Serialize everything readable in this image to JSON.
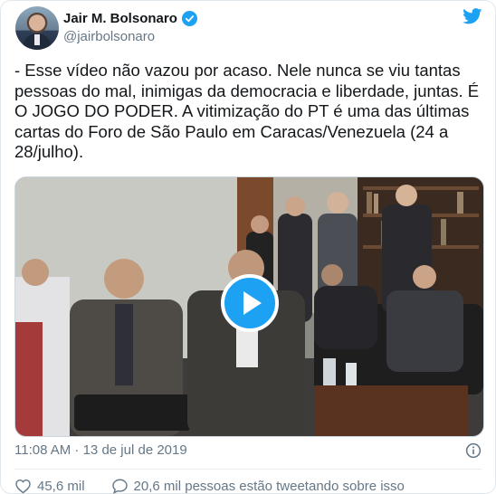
{
  "author": {
    "name": "Jair M. Bolsonaro",
    "handle": "@jairbolsonaro",
    "verified_icon": "verified-badge-icon",
    "brand_icon": "twitter-bird-icon"
  },
  "tweet": {
    "text": "- Esse vídeo não vazou por acaso. Nele nunca se viu tantas pessoas do mal, inimigas da democracia e liberdade, juntas. É O JOGO DO PODER. A vitimização do PT é uma das últimas cartas do Foro de São Paulo em Caracas/Venezuela (24 a 28/julho)."
  },
  "media": {
    "type": "video",
    "play_icon": "play-icon"
  },
  "meta": {
    "timestamp": "11:08 AM · 13 de jul de 2019",
    "info_icon": "info-icon"
  },
  "actions": {
    "like_icon": "heart-icon",
    "likes": "45,6 mil",
    "conversation_icon": "reply-icon",
    "conversation_text": "20,6 mil pessoas estão tweetando sobre isso"
  },
  "colors": {
    "brand_blue": "#1da1f2",
    "text": "#14171a",
    "muted": "#657786",
    "border": "#e1e8ed"
  }
}
